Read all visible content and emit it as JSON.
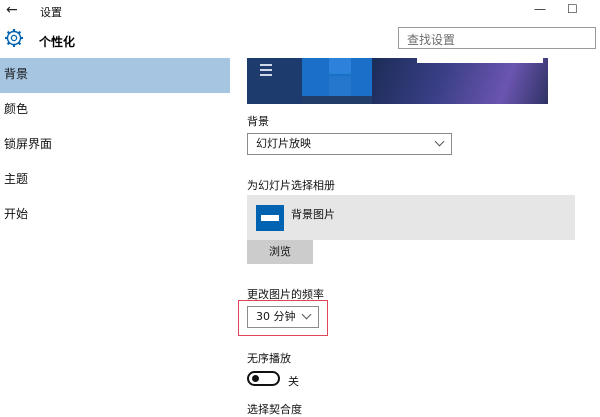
{
  "window": {
    "title": "设置",
    "back_glyph": "←",
    "minimize_glyph": "—",
    "maximize_glyph": "☐"
  },
  "header": {
    "section_title": "个性化",
    "icon": "gear-icon"
  },
  "search": {
    "placeholder": "查找设置"
  },
  "sidebar": {
    "items": [
      {
        "label": "背景",
        "active": true
      },
      {
        "label": "颜色",
        "active": false
      },
      {
        "label": "锁屏界面",
        "active": false
      },
      {
        "label": "主题",
        "active": false
      },
      {
        "label": "开始",
        "active": false
      }
    ]
  },
  "background": {
    "label": "背景",
    "selected": "幻灯片放映"
  },
  "album": {
    "label": "为幻灯片选择相册",
    "name": "背景图片",
    "browse_label": "浏览"
  },
  "frequency": {
    "label": "更改图片的频率",
    "selected": "30 分钟"
  },
  "shuffle": {
    "label": "无序播放",
    "state_label": "关",
    "on": false
  },
  "next_section_partial": "选择契合度",
  "colors": {
    "accent": "#0063b1",
    "nav_active": "#a6c5e1",
    "highlight_box": "#e0455a"
  }
}
